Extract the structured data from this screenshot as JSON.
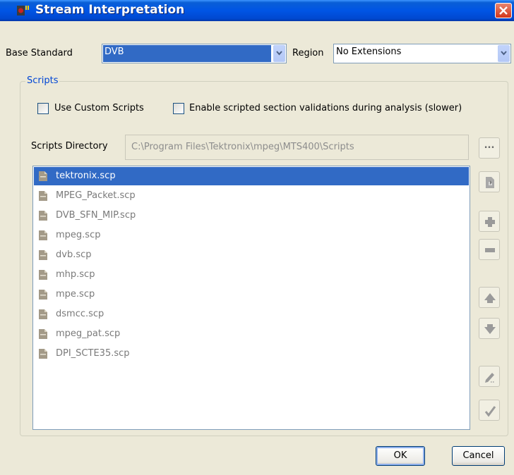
{
  "window": {
    "title": "Stream Interpretation"
  },
  "base_standard": {
    "label": "Base Standard",
    "value": "DVB"
  },
  "region": {
    "label": "Region",
    "value": "No Extensions"
  },
  "scripts": {
    "group_title": "Scripts",
    "use_custom_label": "Use Custom Scripts",
    "enable_validation_label": "Enable scripted section validations during analysis (slower)",
    "directory_label": "Scripts Directory",
    "directory_value": "C:\\Program Files\\Tektronix\\mpeg\\MTS400\\Scripts",
    "browse_label": "...",
    "files": [
      "tektronix.scp",
      "MPEG_Packet.scp",
      "DVB_SFN_MIP.scp",
      "mpeg.scp",
      "dvb.scp",
      "mhp.scp",
      "mpe.scp",
      "dsmcc.scp",
      "mpeg_pat.scp",
      "DPI_SCTE35.scp"
    ],
    "selected_index": 0
  },
  "buttons": {
    "ok": "OK",
    "cancel": "Cancel"
  },
  "colors": {
    "titlebar": "#0055e5",
    "selection": "#316ac5",
    "group_title": "#0046d5"
  }
}
